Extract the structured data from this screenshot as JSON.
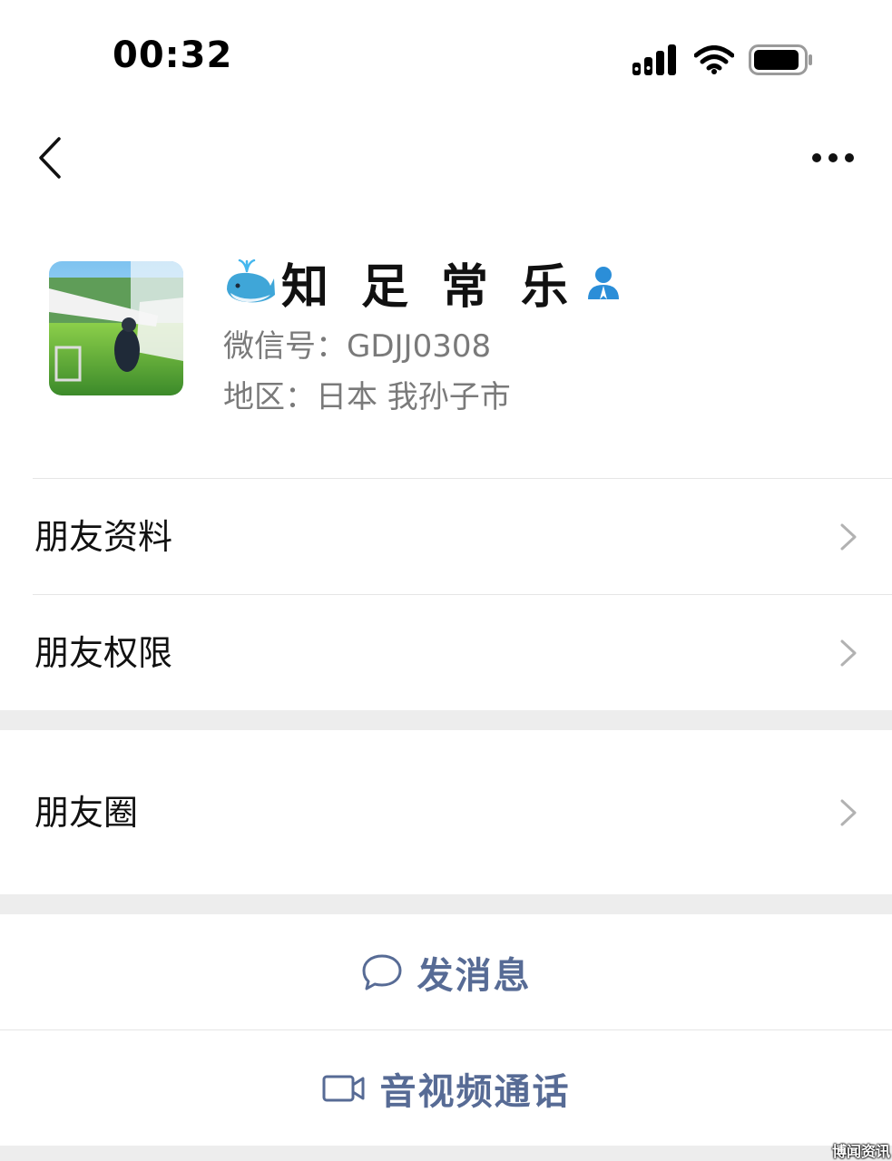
{
  "status_bar": {
    "time": "00:32",
    "battery_level": 0.9
  },
  "nav": {
    "back_icon": "chevron-left-icon",
    "more_icon": "more-dots-icon"
  },
  "profile": {
    "name": "知足常乐",
    "name_prefix_icon": "whale-icon",
    "name_suffix_icon": "verified-user-icon",
    "wechat_id": "微信号：GDJJ0308",
    "region": "地区：日本 我孙子市"
  },
  "menu": {
    "friend_info": "朋友资料",
    "friend_permissions": "朋友权限",
    "moments": "朋友圈"
  },
  "actions": {
    "send_message": "发消息",
    "video_call": "音视频通话"
  },
  "watermark": "博闻资讯",
  "colors": {
    "link": "#576b95",
    "separator": "#ededed",
    "secondary_text": "#7a7a7a"
  }
}
